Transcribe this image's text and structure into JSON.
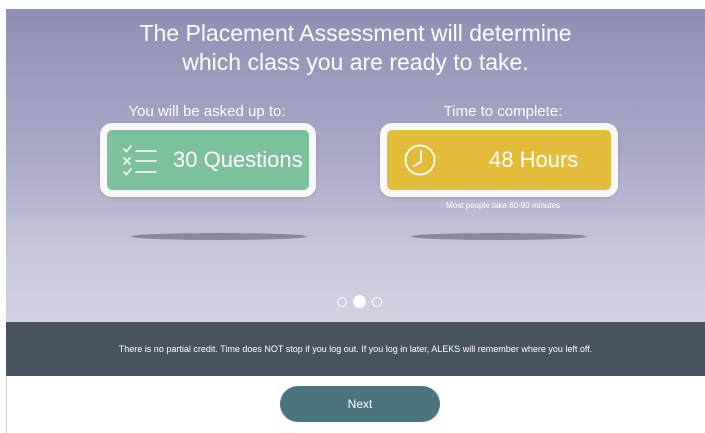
{
  "hero": {
    "headline_line1": "The Placement Assessment will determine",
    "headline_line2": "which class you are ready to take.",
    "questions": {
      "label": "You will be asked up to:",
      "value": "30 Questions",
      "icon": "checklist-icon",
      "color": "#7cc09c"
    },
    "time": {
      "label": "Time to complete:",
      "value": "48 Hours",
      "icon": "clock-icon",
      "note": "Most people take 60-90 minutes",
      "color": "#e3bd39"
    },
    "pagination": {
      "total": 3,
      "active": 2
    }
  },
  "info_bar": {
    "text": "There is no partial credit. Time does NOT stop if you log out. If you log in later, ALEKS will remember where you left off."
  },
  "footer": {
    "next_label": "Next"
  }
}
